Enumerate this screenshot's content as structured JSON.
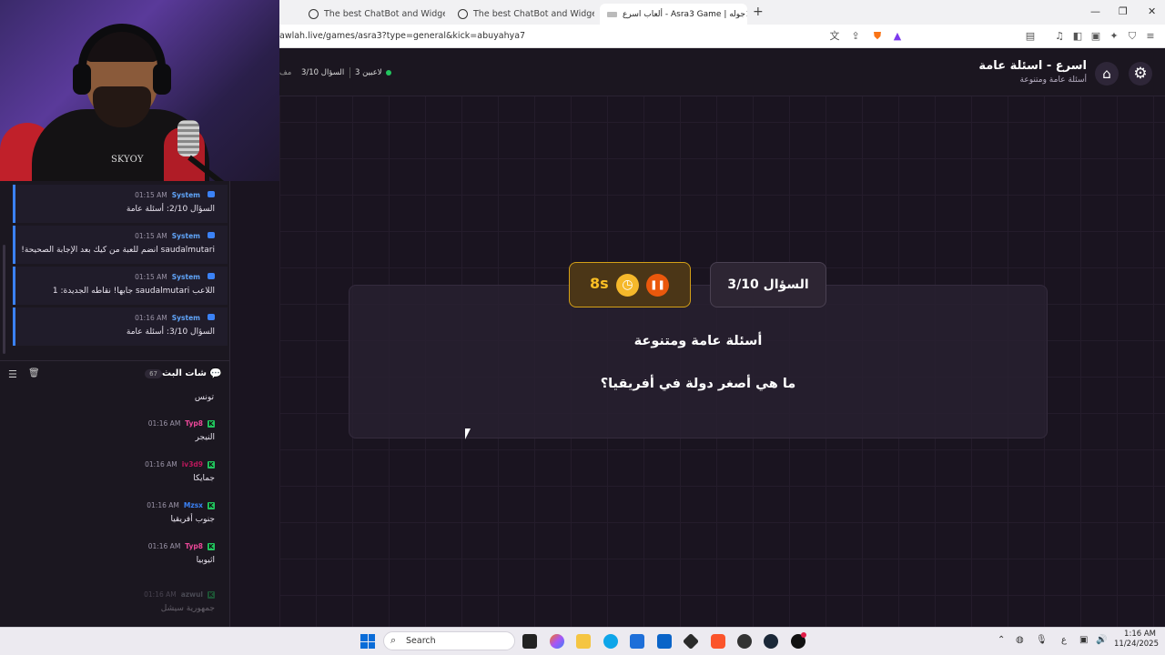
{
  "browser": {
    "tabs": [
      {
        "title": "The best ChatBot and Widgets for Ki",
        "active": false
      },
      {
        "title": "The best ChatBot and Widgets for Ki",
        "active": false
      },
      {
        "title": "ألعاب اسرع - Asra3 Game | جوله",
        "active": true
      }
    ],
    "url": "awlah.live/games/asra3?type=general&kick=abuyahya7"
  },
  "game": {
    "title": "اسرع - اسئلة عامة",
    "subtitle": "أسئلة عامة ومتنوعة",
    "players": "3 لاعبين",
    "question_progress": "السؤال 3/10",
    "cut_text": "مف",
    "question_number": "السؤال 3/10",
    "timer": "8s",
    "category": "أسئلة عامة ومتنوعة",
    "question": "ما هي أصغر دولة في أفريقيا؟"
  },
  "system_messages": [
    {
      "name": "System",
      "time": "01:15 AM",
      "text": "السؤال 2/10: أسئلة عامة"
    },
    {
      "name": "System",
      "time": "01:15 AM",
      "text": "saudalmutari انضم للعبة من كيك بعد الإجابة الصحيحة!"
    },
    {
      "name": "System",
      "time": "01:15 AM",
      "text": "اللاعب saudalmutari جابها! نقاطه الجديدة: 1"
    },
    {
      "name": "System",
      "time": "01:16 AM",
      "text": "السؤال 3/10: أسئلة عامة"
    }
  ],
  "chat": {
    "title": "شات البث",
    "count": "67",
    "top_partial_text": "تونس",
    "messages": [
      {
        "user": "Typ8",
        "time": "01:16 AM",
        "text": "النيجر",
        "color": "#ec4899"
      },
      {
        "user": "iv3d9",
        "time": "01:16 AM",
        "text": "جمايكا",
        "color": "#be185d"
      },
      {
        "user": "Mzsx",
        "time": "01:16 AM",
        "text": "جنوب أفريقيا",
        "color": "#3b82f6"
      },
      {
        "user": "Typ8",
        "time": "01:16 AM",
        "text": "اثيوبيا",
        "color": "#ec4899"
      },
      {
        "user": "azwul",
        "time": "01:16 AM",
        "text": "جمهورية سيشل",
        "color": "#6b7280"
      }
    ]
  },
  "webcam": {
    "shirt_text": "SKYOY"
  },
  "taskbar": {
    "search_placeholder": "Search",
    "time": "1:16 AM",
    "date": "11/24/2025",
    "lang": "ع"
  }
}
